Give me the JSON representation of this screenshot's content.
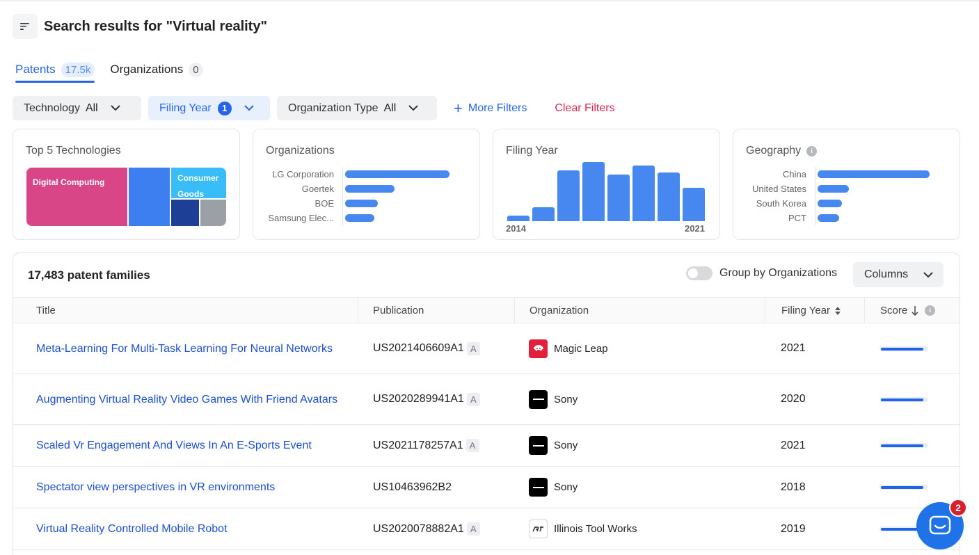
{
  "header": {
    "title": "Search results for \"Virtual reality\""
  },
  "tabs": [
    {
      "label": "Patents",
      "count": "17.5k"
    },
    {
      "label": "Organizations",
      "count": "0"
    }
  ],
  "filters": {
    "technology": {
      "label": "Technology",
      "value": "All"
    },
    "filing_year": {
      "label": "Filing Year",
      "badge": "1"
    },
    "organization_type": {
      "label": "Organization Type",
      "value": "All"
    },
    "more_filters": "More Filters",
    "clear_filters": "Clear Filters"
  },
  "cards": {
    "technologies": {
      "title": "Top 5 Technologies",
      "tiles": [
        {
          "label": "Digital Computing",
          "color": "#d94688"
        },
        {
          "label": "",
          "color": "#3d7ff0"
        },
        {
          "label": "Consumer Goods",
          "color": "#38bdf8"
        },
        {
          "label": "",
          "color": "#1e3f96"
        },
        {
          "label": "",
          "color": "#9aa0a6"
        }
      ]
    },
    "organizations": {
      "title": "Organizations",
      "items": [
        {
          "label": "LG Corporation",
          "value": 1.0
        },
        {
          "label": "Goertek",
          "value": 0.47
        },
        {
          "label": "BOE",
          "value": 0.31
        },
        {
          "label": "Samsung Elec...",
          "value": 0.28
        }
      ]
    },
    "filing_year": {
      "title": "Filing Year",
      "start_label": "2014",
      "end_label": "2021",
      "values": [
        0.09,
        0.23,
        0.86,
        1.0,
        0.79,
        0.94,
        0.82,
        0.57
      ]
    },
    "geography": {
      "title": "Geography",
      "items": [
        {
          "label": "China",
          "value": 1.0
        },
        {
          "label": "United States",
          "value": 0.28
        },
        {
          "label": "South Korea",
          "value": 0.22
        },
        {
          "label": "PCT",
          "value": 0.19
        }
      ]
    }
  },
  "results": {
    "count_label": "17,483 patent families",
    "group_by_label": "Group by Organizations",
    "group_by_on": false,
    "columns_label": "Columns",
    "headers": {
      "title": "Title",
      "publication": "Publication",
      "organization": "Organization",
      "filing_year": "Filing Year",
      "score": "Score"
    },
    "rows": [
      {
        "title": "Meta-Learning For Multi-Task Learning For Neural Networks",
        "publication": "US2021406609A1",
        "kind": "A",
        "organization": "Magic Leap",
        "logo": "magic-leap",
        "year": "2021",
        "score": 0.93
      },
      {
        "title": "Augmenting Virtual Reality Video Games With Friend Avatars",
        "publication": "US2020289941A1",
        "kind": "A",
        "organization": "Sony",
        "logo": "sony",
        "year": "2020",
        "score": 0.93
      },
      {
        "title": "Scaled Vr Engagement And Views In An E-Sports Event",
        "publication": "US2021178257A1",
        "kind": "A",
        "organization": "Sony",
        "logo": "sony",
        "year": "2021",
        "score": 0.93
      },
      {
        "title": "Spectator view perspectives in VR environments",
        "publication": "US10463962B2",
        "kind": "",
        "organization": "Sony",
        "logo": "sony",
        "year": "2018",
        "score": 0.93
      },
      {
        "title": "Virtual Reality Controlled Mobile Robot",
        "publication": "US2020078882A1",
        "kind": "A",
        "organization": "Illinois Tool Works",
        "logo": "itw",
        "year": "2019",
        "score": 0.93
      }
    ]
  },
  "chat": {
    "badge": "2"
  },
  "colors": {
    "accent": "#2563eb",
    "danger": "#dc2650",
    "bar": "#4687f0"
  }
}
